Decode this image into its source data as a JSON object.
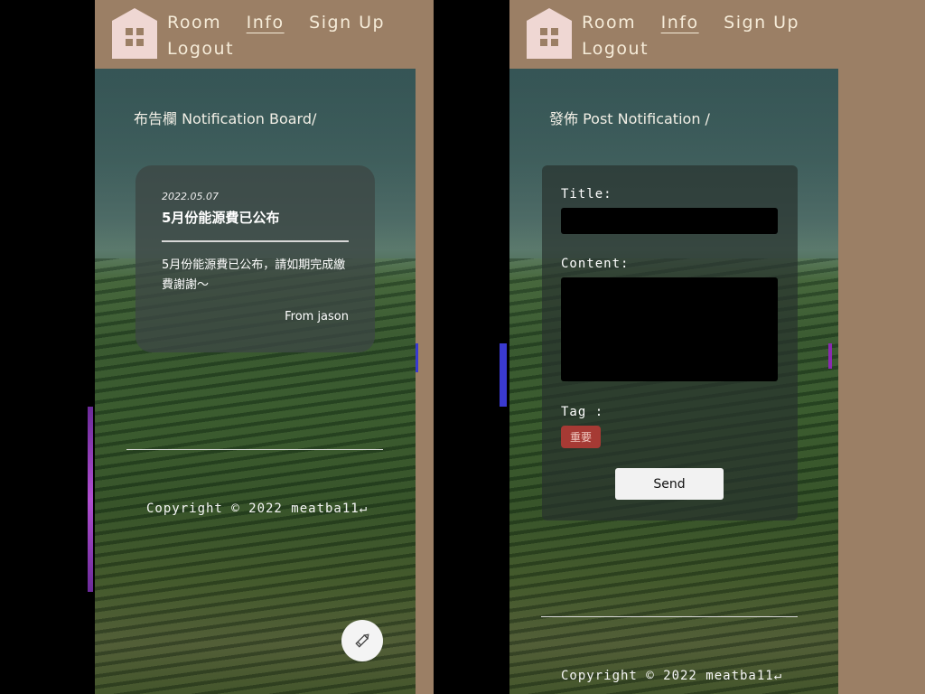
{
  "nav": {
    "items": [
      "Room",
      "Info",
      "Sign Up",
      "Logout"
    ],
    "active": "Info"
  },
  "board": {
    "title": "布告欄 Notification Board/",
    "notice": {
      "date": "2022.05.07",
      "title": "5月份能源費已公布",
      "body": "5月份能源費已公布，請如期完成繳費謝謝～",
      "from": "From jason"
    },
    "edit_icon": "pencil-icon"
  },
  "post": {
    "title": "發佈 Post Notification /",
    "title_label": "Title:",
    "title_value": "",
    "content_label": "Content:",
    "content_value": "",
    "tag_label": "Tag :",
    "tag_value": "重要",
    "send_label": "Send"
  },
  "footer": {
    "copyright": "Copyright © 2022 meatba11↵"
  },
  "colors": {
    "panel_bg": "#9b7f65",
    "logo": "#efd7d3",
    "tag": "#a63a34"
  }
}
